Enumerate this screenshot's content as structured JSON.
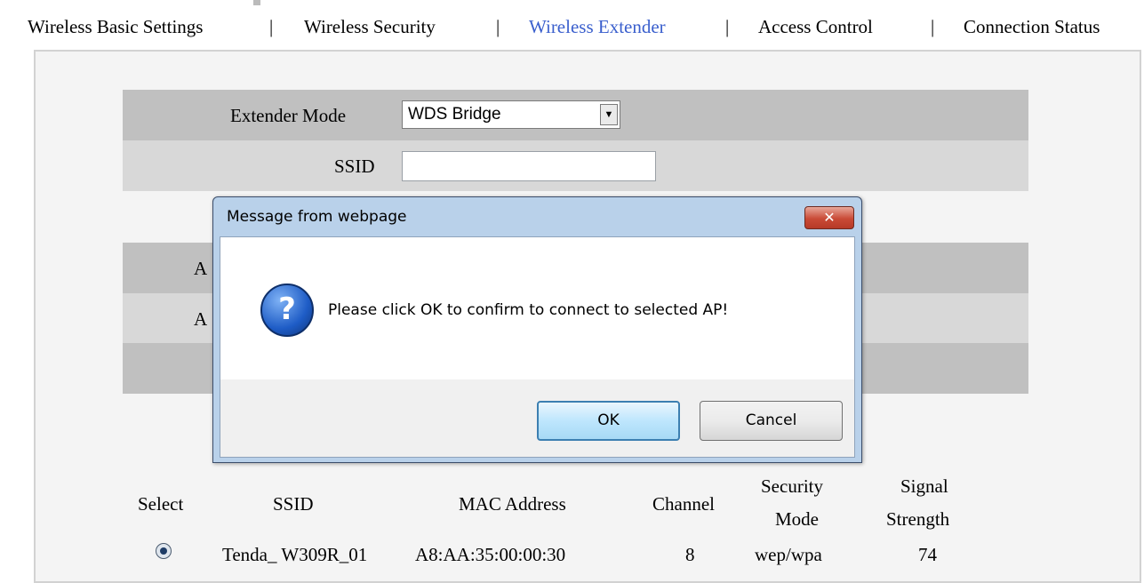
{
  "nav": {
    "items": [
      {
        "label": "Wireless Basic Settings",
        "active": false
      },
      {
        "label": "Wireless Security",
        "active": false
      },
      {
        "label": "Wireless Extender",
        "active": true
      },
      {
        "label": "Access Control",
        "active": false
      },
      {
        "label": "Connection Status",
        "active": false
      }
    ],
    "separator": "|",
    "active_color": "#3a5fcd"
  },
  "form": {
    "extender_mode_label": "Extender Mode",
    "extender_mode_value": "WDS Bridge",
    "ssid_label": "SSID",
    "ssid_value": "",
    "hidden_row_a1": "A",
    "hidden_row_a2": "A"
  },
  "ap_table": {
    "headers": {
      "select": "Select",
      "ssid": "SSID",
      "mac": "MAC Address",
      "channel": "Channel",
      "security_line1": "Security",
      "security_line2": "Mode",
      "signal_line1": "Signal",
      "signal_line2": "Strength"
    },
    "rows": [
      {
        "selected": true,
        "ssid": "Tenda_ W309R_01",
        "mac": "A8:AA:35:00:00:30",
        "channel": "8",
        "security": "wep/wpa",
        "signal": "74"
      }
    ]
  },
  "dialog": {
    "title": "Message from webpage",
    "close_glyph": "✕",
    "icon": "question-icon",
    "icon_glyph": "?",
    "message": "Please click OK to confirm to connect to selected AP!",
    "ok_label": "OK",
    "cancel_label": "Cancel"
  }
}
